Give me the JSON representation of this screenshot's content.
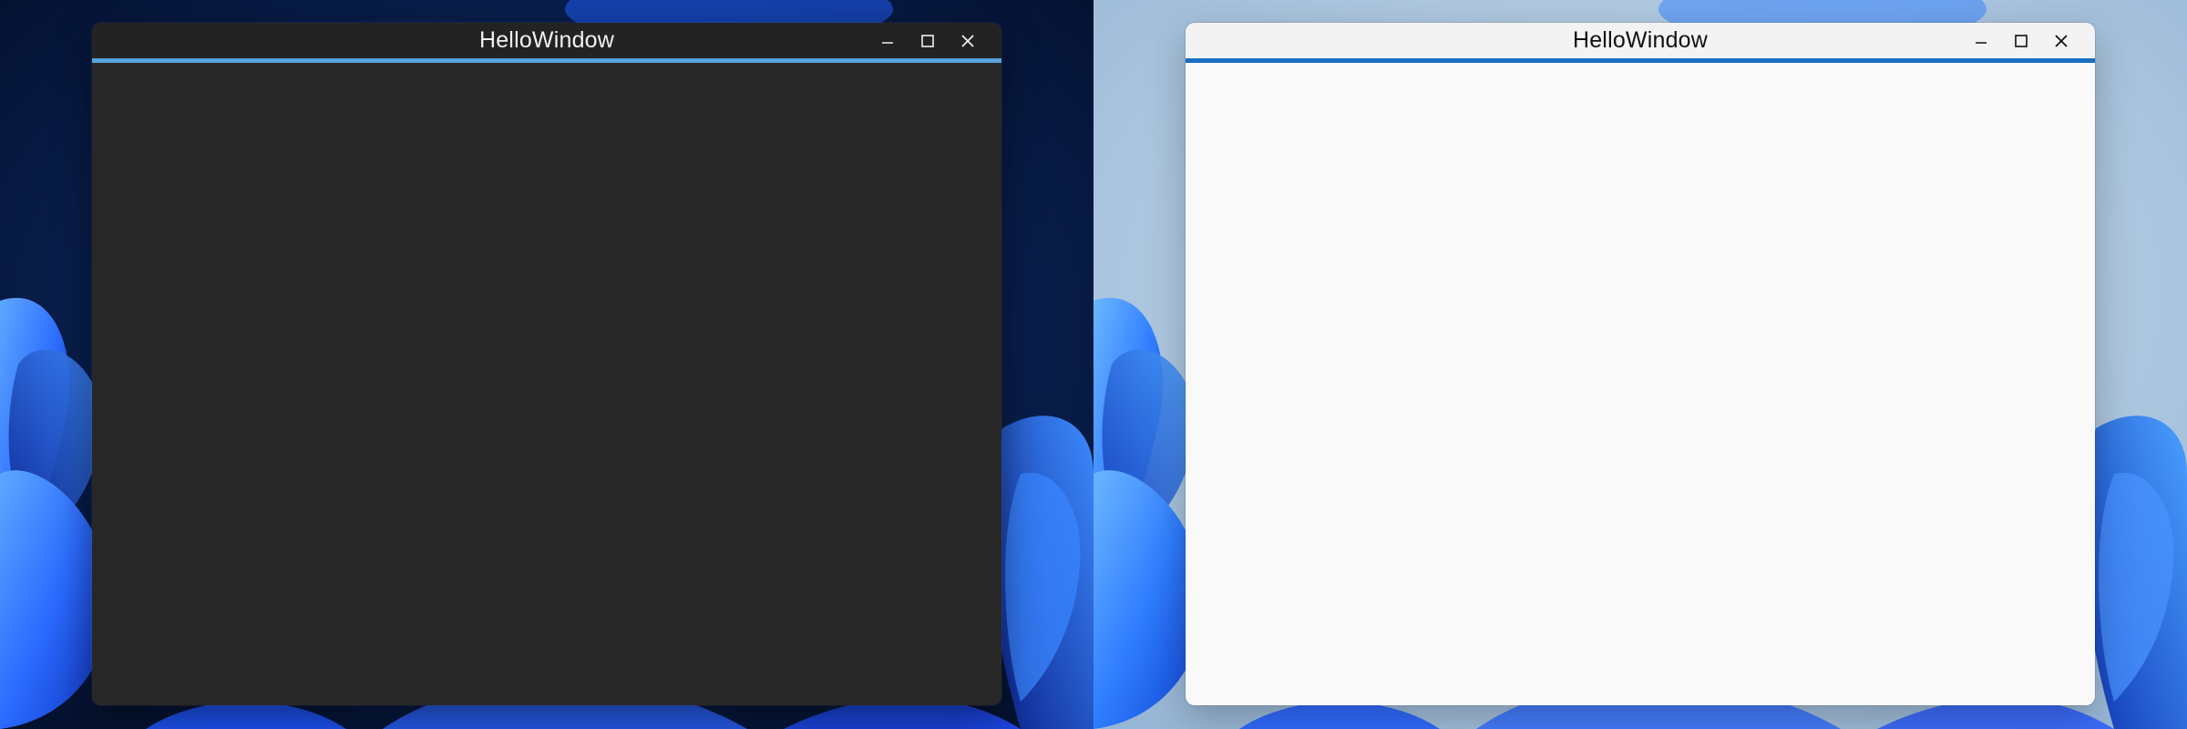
{
  "screens": [
    {
      "theme": "dark",
      "window": {
        "title": "HelloWindow",
        "accent_color": "#5ba3dc",
        "titlebar_color": "#232323",
        "client_color": "#272727"
      },
      "controls": {
        "minimize_icon": "minimize-icon",
        "maximize_icon": "maximize-icon",
        "close_icon": "close-icon"
      },
      "wallpaper": {
        "style": "windows-11-bloom-dark",
        "background_color": "#0a1a3a",
        "bloom_color": "#1f5fff"
      }
    },
    {
      "theme": "light",
      "window": {
        "title": "HelloWindow",
        "accent_color": "#1a6fc0",
        "titlebar_color": "#f3f3f3",
        "client_color": "#f9f9f9"
      },
      "controls": {
        "minimize_icon": "minimize-icon",
        "maximize_icon": "maximize-icon",
        "close_icon": "close-icon"
      },
      "wallpaper": {
        "style": "windows-11-bloom-light",
        "background_color": "#a9c4de",
        "bloom_color": "#1f5fff"
      }
    }
  ]
}
